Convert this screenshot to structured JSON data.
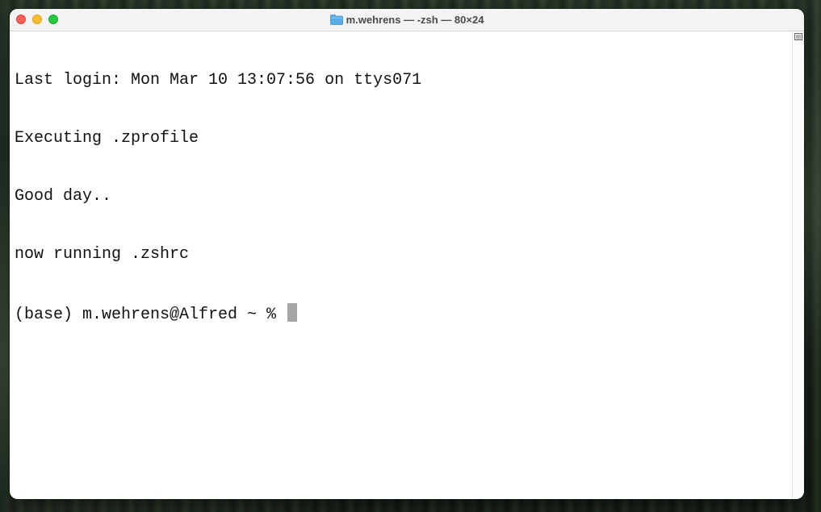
{
  "window": {
    "title": "m.wehrens — -zsh — 80×24"
  },
  "terminal": {
    "lines": [
      "Last login: Mon Mar 10 13:07:56 on ttys071",
      "Executing .zprofile",
      "Good day..",
      "now running .zshrc"
    ],
    "prompt": "(base) m.wehrens@Alfred ~ % "
  },
  "icons": {
    "title_icon": "folder-icon",
    "scrollbar_icon": "split-pane-icon"
  },
  "colors": {
    "close": "#ff5f57",
    "minimize": "#febc2e",
    "zoom": "#28c840",
    "folder": "#5aaee8",
    "cursor": "#a5a5a5"
  }
}
